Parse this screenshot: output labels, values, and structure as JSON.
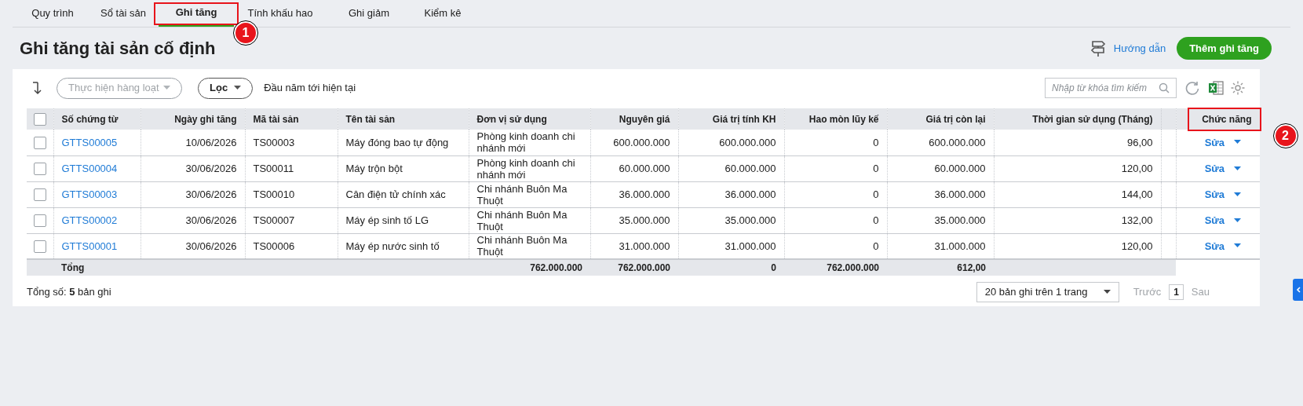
{
  "tabs": [
    {
      "label": "Quy trình",
      "selected": false
    },
    {
      "label": "Sổ tài sản",
      "selected": false
    },
    {
      "label": "Ghi tăng",
      "selected": true,
      "callout": "1"
    },
    {
      "label": "Tính khấu hao",
      "selected": false
    },
    {
      "label": "Ghi giảm",
      "selected": false
    },
    {
      "label": "Kiểm kê",
      "selected": false
    }
  ],
  "page_title": "Ghi tăng tài sản cố định",
  "guide_link": "Hướng dẫn",
  "add_button": "Thêm ghi tăng",
  "toolbar": {
    "bulk_action": "Thực hiện hàng loạt",
    "filter": "Lọc",
    "period": "Đầu năm tới hiện tại",
    "search": {
      "placeholder": "Nhập từ khóa tìm kiếm"
    }
  },
  "table": {
    "select_all_checked": false,
    "columns": [
      {
        "label": "Số chứng từ"
      },
      {
        "label": "Ngày ghi tăng"
      },
      {
        "label": "Mã tài sản"
      },
      {
        "label": "Tên tài sản"
      },
      {
        "label": "Đơn vị sử dụng"
      },
      {
        "label": "Nguyên giá"
      },
      {
        "label": "Giá trị tính KH"
      },
      {
        "label": "Hao mòn lũy kế"
      },
      {
        "label": "Giá trị còn lại"
      },
      {
        "label": "Thời gian sử dụng (Tháng)"
      },
      {
        "label": "Chức năng",
        "callout": "2"
      }
    ],
    "rows": [
      {
        "checked": false,
        "cells": [
          "GTTS00005",
          "10/06/2026",
          "TS00003",
          "Máy đóng bao tự động",
          "Phòng kinh doanh chi nhánh mới",
          "600.000.000",
          "600.000.000",
          "0",
          "600.000.000",
          "96,00"
        ],
        "action": "Sửa"
      },
      {
        "checked": false,
        "cells": [
          "GTTS00004",
          "30/06/2026",
          "TS00011",
          "Máy trộn bột",
          "Phòng kinh doanh chi nhánh mới",
          "60.000.000",
          "60.000.000",
          "0",
          "60.000.000",
          "120,00"
        ],
        "action": "Sửa"
      },
      {
        "checked": false,
        "cells": [
          "GTTS00003",
          "30/06/2026",
          "TS00010",
          "Cân điện tử chính xác",
          "Chi nhánh Buôn Ma Thuột",
          "36.000.000",
          "36.000.000",
          "0",
          "36.000.000",
          "144,00"
        ],
        "action": "Sửa"
      },
      {
        "checked": false,
        "cells": [
          "GTTS00002",
          "30/06/2026",
          "TS00007",
          "Máy ép sinh tố LG",
          "Chi nhánh Buôn Ma Thuột",
          "35.000.000",
          "35.000.000",
          "0",
          "35.000.000",
          "132,00"
        ],
        "action": "Sửa"
      },
      {
        "checked": false,
        "cells": [
          "GTTS00001",
          "30/06/2026",
          "TS00006",
          "Máy ép nước sinh tố",
          "Chi nhánh Buôn Ma Thuột",
          "31.000.000",
          "31.000.000",
          "0",
          "31.000.000",
          "120,00"
        ],
        "action": "Sửa"
      }
    ],
    "total_row": {
      "label": "Tổng",
      "cells": [
        "762.000.000",
        "762.000.000",
        "0",
        "762.000.000",
        "612,00"
      ]
    }
  },
  "footer": {
    "record_count": "Tổng số: **5** bản ghi",
    "page_size": "20 bản ghi trên 1 trang",
    "prev": "Trước",
    "page": "1",
    "next": "Sau",
    "prev_disabled": true,
    "next_disabled": true
  }
}
